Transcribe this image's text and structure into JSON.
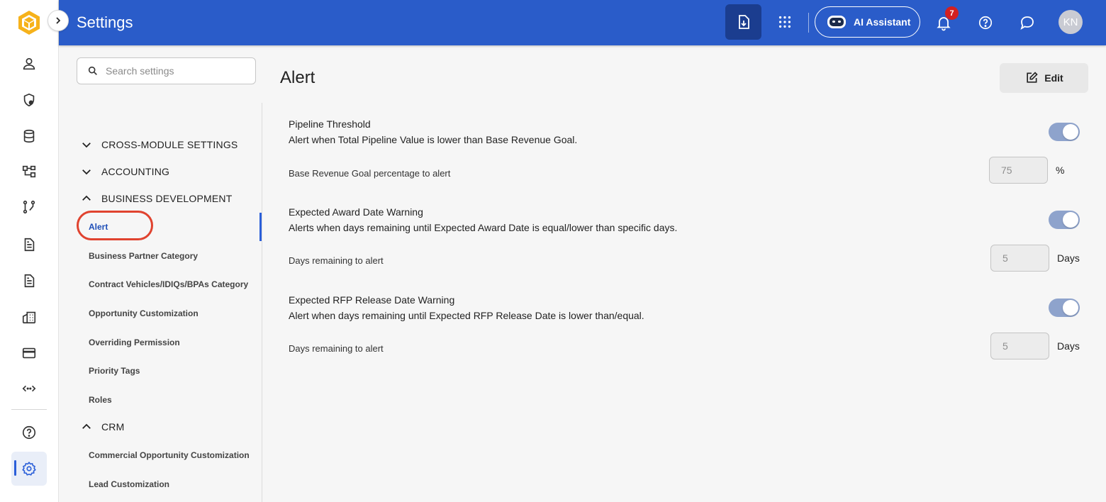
{
  "header": {
    "title": "Settings",
    "ai_assistant_label": "AI Assistant",
    "notification_count": "7",
    "avatar_initials": "KN",
    "color": "#2a5cc9"
  },
  "rail": {
    "icons": [
      "user-icon",
      "shield-icon",
      "database-icon",
      "workflow-icon",
      "pipeline-icon",
      "document-icon",
      "document-alt-icon",
      "buildings-icon",
      "credit-card-icon",
      "code-icon",
      "help-icon",
      "settings-icon"
    ],
    "active": "settings-icon"
  },
  "sidebar": {
    "search_placeholder": "Search settings",
    "sections": [
      {
        "label": "CROSS-MODULE SETTINGS",
        "expanded": false
      },
      {
        "label": "ACCOUNTING",
        "expanded": false
      },
      {
        "label": "BUSINESS DEVELOPMENT",
        "expanded": true,
        "items": [
          "Alert",
          "Business Partner Category",
          "Contract Vehicles/IDIQs/BPAs Category",
          "Opportunity Customization",
          "Overriding Permission",
          "Priority Tags",
          "Roles"
        ]
      },
      {
        "label": "CRM",
        "expanded": true,
        "items": [
          "Commercial Opportunity Customization",
          "Lead Customization"
        ]
      }
    ],
    "active_item": "Alert"
  },
  "main": {
    "title": "Alert",
    "edit_label": "Edit",
    "blocks": [
      {
        "title": "Pipeline Threshold",
        "description": "Alert when Total Pipeline Value is lower than Base Revenue Goal.",
        "enabled": true,
        "field_label": "Base Revenue Goal percentage to alert",
        "value": "75",
        "unit": "%"
      },
      {
        "title": "Expected Award Date Warning",
        "description": "Alerts when days remaining until Expected Award Date is equal/lower than specific days.",
        "enabled": true,
        "field_label": "Days remaining to alert",
        "value": "5",
        "unit": "Days"
      },
      {
        "title": "Expected RFP Release Date Warning",
        "description": "Alert when days remaining until Expected RFP Release Date is lower than/equal.",
        "enabled": true,
        "field_label": "Days remaining to alert",
        "value": "5",
        "unit": "Days"
      }
    ]
  }
}
